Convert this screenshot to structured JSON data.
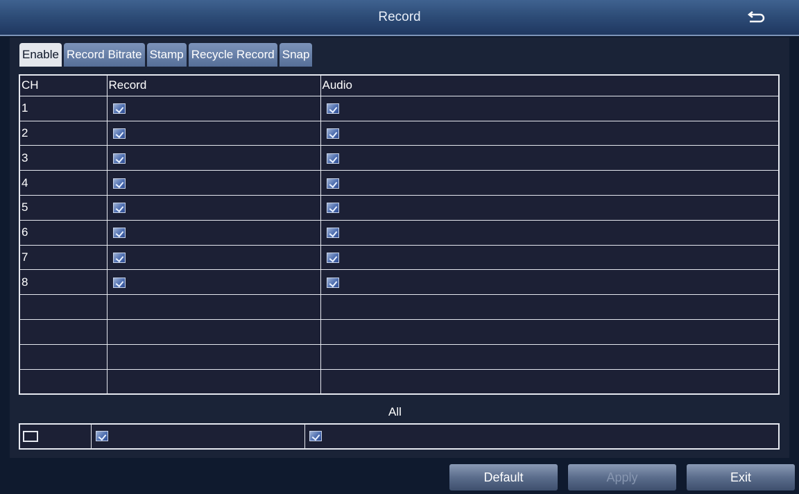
{
  "window": {
    "title": "Record",
    "back_icon": "return-arrow-icon"
  },
  "tabs": [
    {
      "label": "Enable",
      "active": true
    },
    {
      "label": "Record Bitrate",
      "active": false
    },
    {
      "label": "Stamp",
      "active": false
    },
    {
      "label": "Recycle Record",
      "active": false
    },
    {
      "label": "Snap",
      "active": false
    }
  ],
  "table": {
    "headers": {
      "ch": "CH",
      "record": "Record",
      "audio": "Audio"
    },
    "rows": [
      {
        "ch": "1",
        "record": true,
        "audio": true
      },
      {
        "ch": "2",
        "record": true,
        "audio": true
      },
      {
        "ch": "3",
        "record": true,
        "audio": true
      },
      {
        "ch": "4",
        "record": true,
        "audio": true
      },
      {
        "ch": "5",
        "record": true,
        "audio": true
      },
      {
        "ch": "6",
        "record": true,
        "audio": true
      },
      {
        "ch": "7",
        "record": true,
        "audio": true
      },
      {
        "ch": "8",
        "record": true,
        "audio": true
      }
    ]
  },
  "all": {
    "label": "All",
    "select_all": false,
    "record": true,
    "audio": true
  },
  "buttons": {
    "default": "Default",
    "apply": "Apply",
    "exit": "Exit"
  },
  "colors": {
    "title_bar": "#2e4d78",
    "background": "#1c2035",
    "checkbox_checked": "#4f6fb0"
  }
}
